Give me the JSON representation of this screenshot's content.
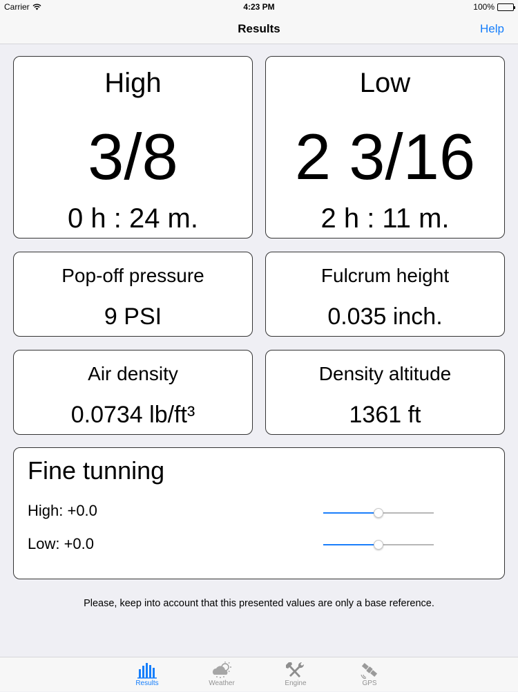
{
  "status": {
    "carrier": "Carrier",
    "time": "4:23 PM",
    "battery": "100%"
  },
  "nav": {
    "title": "Results",
    "help": "Help"
  },
  "high": {
    "label": "High",
    "value": "3/8",
    "time": "0 h : 24 m."
  },
  "low": {
    "label": "Low",
    "value": "2 3/16",
    "time": "2 h : 11 m."
  },
  "pop_off": {
    "label": "Pop-off pressure",
    "value": "9 PSI"
  },
  "fulcrum": {
    "label": "Fulcrum height",
    "value": "0.035 inch."
  },
  "air_density": {
    "label": "Air density",
    "value": "0.0734 lb/ft³"
  },
  "density_altitude": {
    "label": "Density altitude",
    "value": "1361 ft"
  },
  "fine_tuning": {
    "title": "Fine tunning",
    "high_label": "High: +0.0",
    "low_label": "Low: +0.0",
    "high_slider": 0.5,
    "low_slider": 0.5
  },
  "disclaimer": "Please, keep into account that this presented values are only a base reference.",
  "tabs": [
    {
      "label": "Results",
      "icon": "bar-chart-icon",
      "active": true
    },
    {
      "label": "Weather",
      "icon": "weather-icon",
      "active": false
    },
    {
      "label": "Engine",
      "icon": "tools-icon",
      "active": false
    },
    {
      "label": "GPS",
      "icon": "satellite-icon",
      "active": false
    }
  ],
  "colors": {
    "accent": "#157efb",
    "background": "#efeff4",
    "tab_inactive": "#929292"
  }
}
